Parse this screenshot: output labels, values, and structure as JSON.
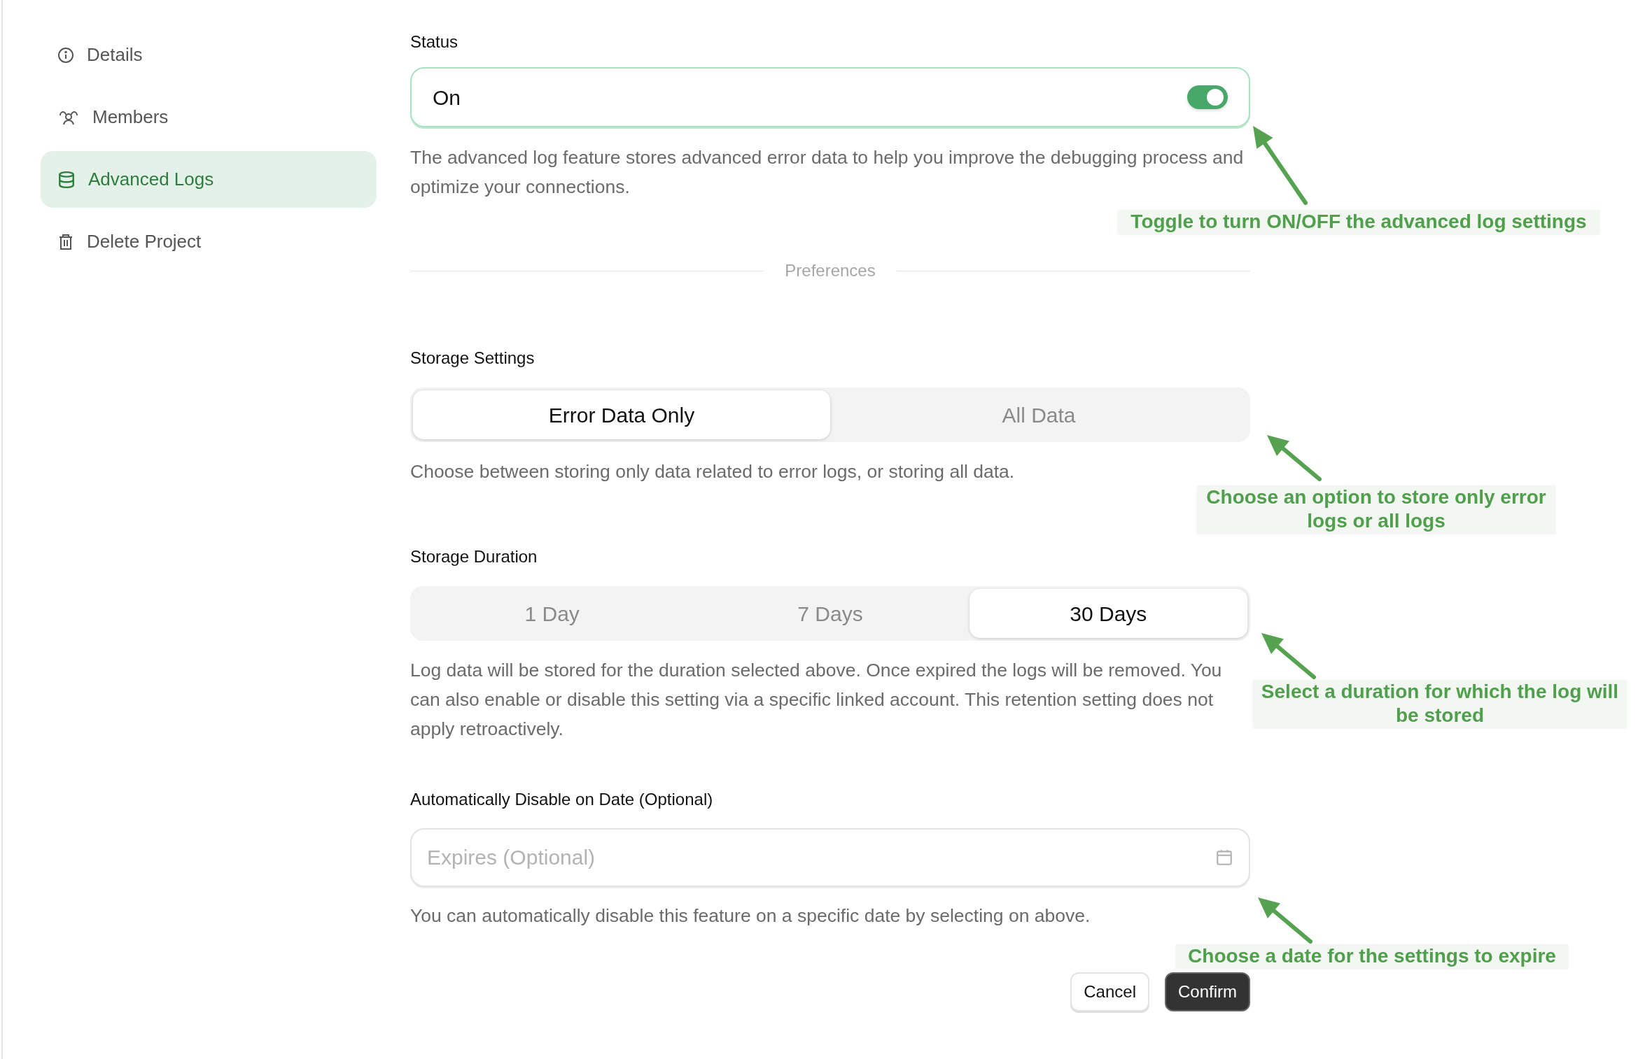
{
  "sidebar": {
    "items": [
      {
        "label": "Details",
        "selected": false
      },
      {
        "label": "Members",
        "selected": false
      },
      {
        "label": "Advanced Logs",
        "selected": true
      },
      {
        "label": "Delete Project",
        "selected": false
      }
    ]
  },
  "status": {
    "label": "Status",
    "value": "On",
    "on": true,
    "description": "The advanced log feature stores advanced error data to help you improve the debugging process and optimize your connections."
  },
  "divider_label": "Preferences",
  "storage_settings": {
    "label": "Storage Settings",
    "options": [
      {
        "label": "Error Data Only",
        "selected": true
      },
      {
        "label": "All Data",
        "selected": false
      }
    ],
    "description": "Choose between storing only data related to error logs, or storing all data."
  },
  "storage_duration": {
    "label": "Storage Duration",
    "options": [
      {
        "label": "1 Day",
        "selected": false
      },
      {
        "label": "7 Days",
        "selected": false
      },
      {
        "label": "30 Days",
        "selected": true
      }
    ],
    "description": "Log data will be stored for the duration selected above. Once expired the logs will be removed. You can also enable or disable this setting via a specific linked account. This retention setting does not apply retroactively."
  },
  "auto_disable": {
    "label": "Automatically Disable on Date (Optional)",
    "placeholder": "Expires (Optional)",
    "description": "You can automatically disable this feature on a specific date by selecting on above."
  },
  "buttons": [
    {
      "label": "Cancel",
      "kind": "secondary"
    },
    {
      "label": "Confirm",
      "kind": "primary"
    }
  ],
  "annotations": [
    {
      "text": "Toggle to turn ON/OFF the advanced log settings"
    },
    {
      "text": "Choose an option to store only error logs or all logs"
    },
    {
      "text": "Select a duration for which the log will be stored"
    },
    {
      "text": "Choose a date for the settings to expire"
    }
  ]
}
